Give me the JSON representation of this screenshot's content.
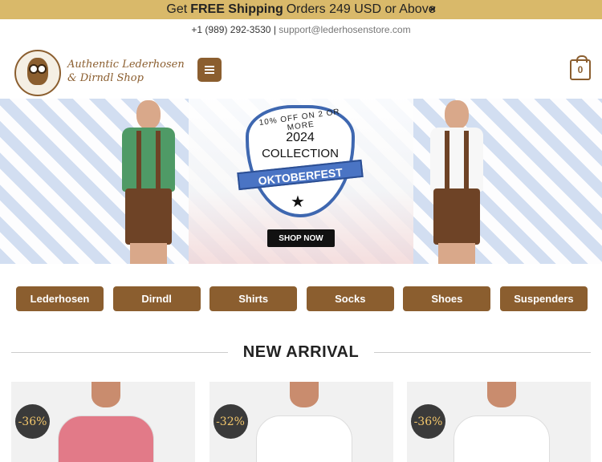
{
  "topbar": {
    "prefix": "Get",
    "bold": "FREE Shipping",
    "suffix": "Orders 249 USD or Above",
    "close_icon": "×"
  },
  "contact": {
    "phone": "+1 (989) 292-3530",
    "separator": "|",
    "email": "support@lederhosenstore.com"
  },
  "header": {
    "logo_line1": "Authentic Lederhosen",
    "logo_line2": "& Dirndl Shop",
    "cart_count": "0"
  },
  "banner": {
    "badge_arc": "10% OFF ON 2 OR MORE",
    "year": "2024",
    "collection": "COLLECTION",
    "ribbon": "OKTOBERFEST",
    "star": "★",
    "shop_button": "SHOP NOW"
  },
  "categories": [
    "Lederhosen",
    "Dirndl",
    "Shirts",
    "Socks",
    "Shoes",
    "Suspenders"
  ],
  "section": {
    "title": "NEW ARRIVAL"
  },
  "products": [
    {
      "discount": "-36%",
      "shirt_color": "#e27a88"
    },
    {
      "discount": "-32%",
      "shirt_color": "#ffffff"
    },
    {
      "discount": "-36%",
      "shirt_color": "#ffffff"
    }
  ],
  "colors": {
    "topbar": "#d9b96a",
    "brand_brown": "#8b5e2f",
    "ribbon_blue": "#4a74c4"
  }
}
